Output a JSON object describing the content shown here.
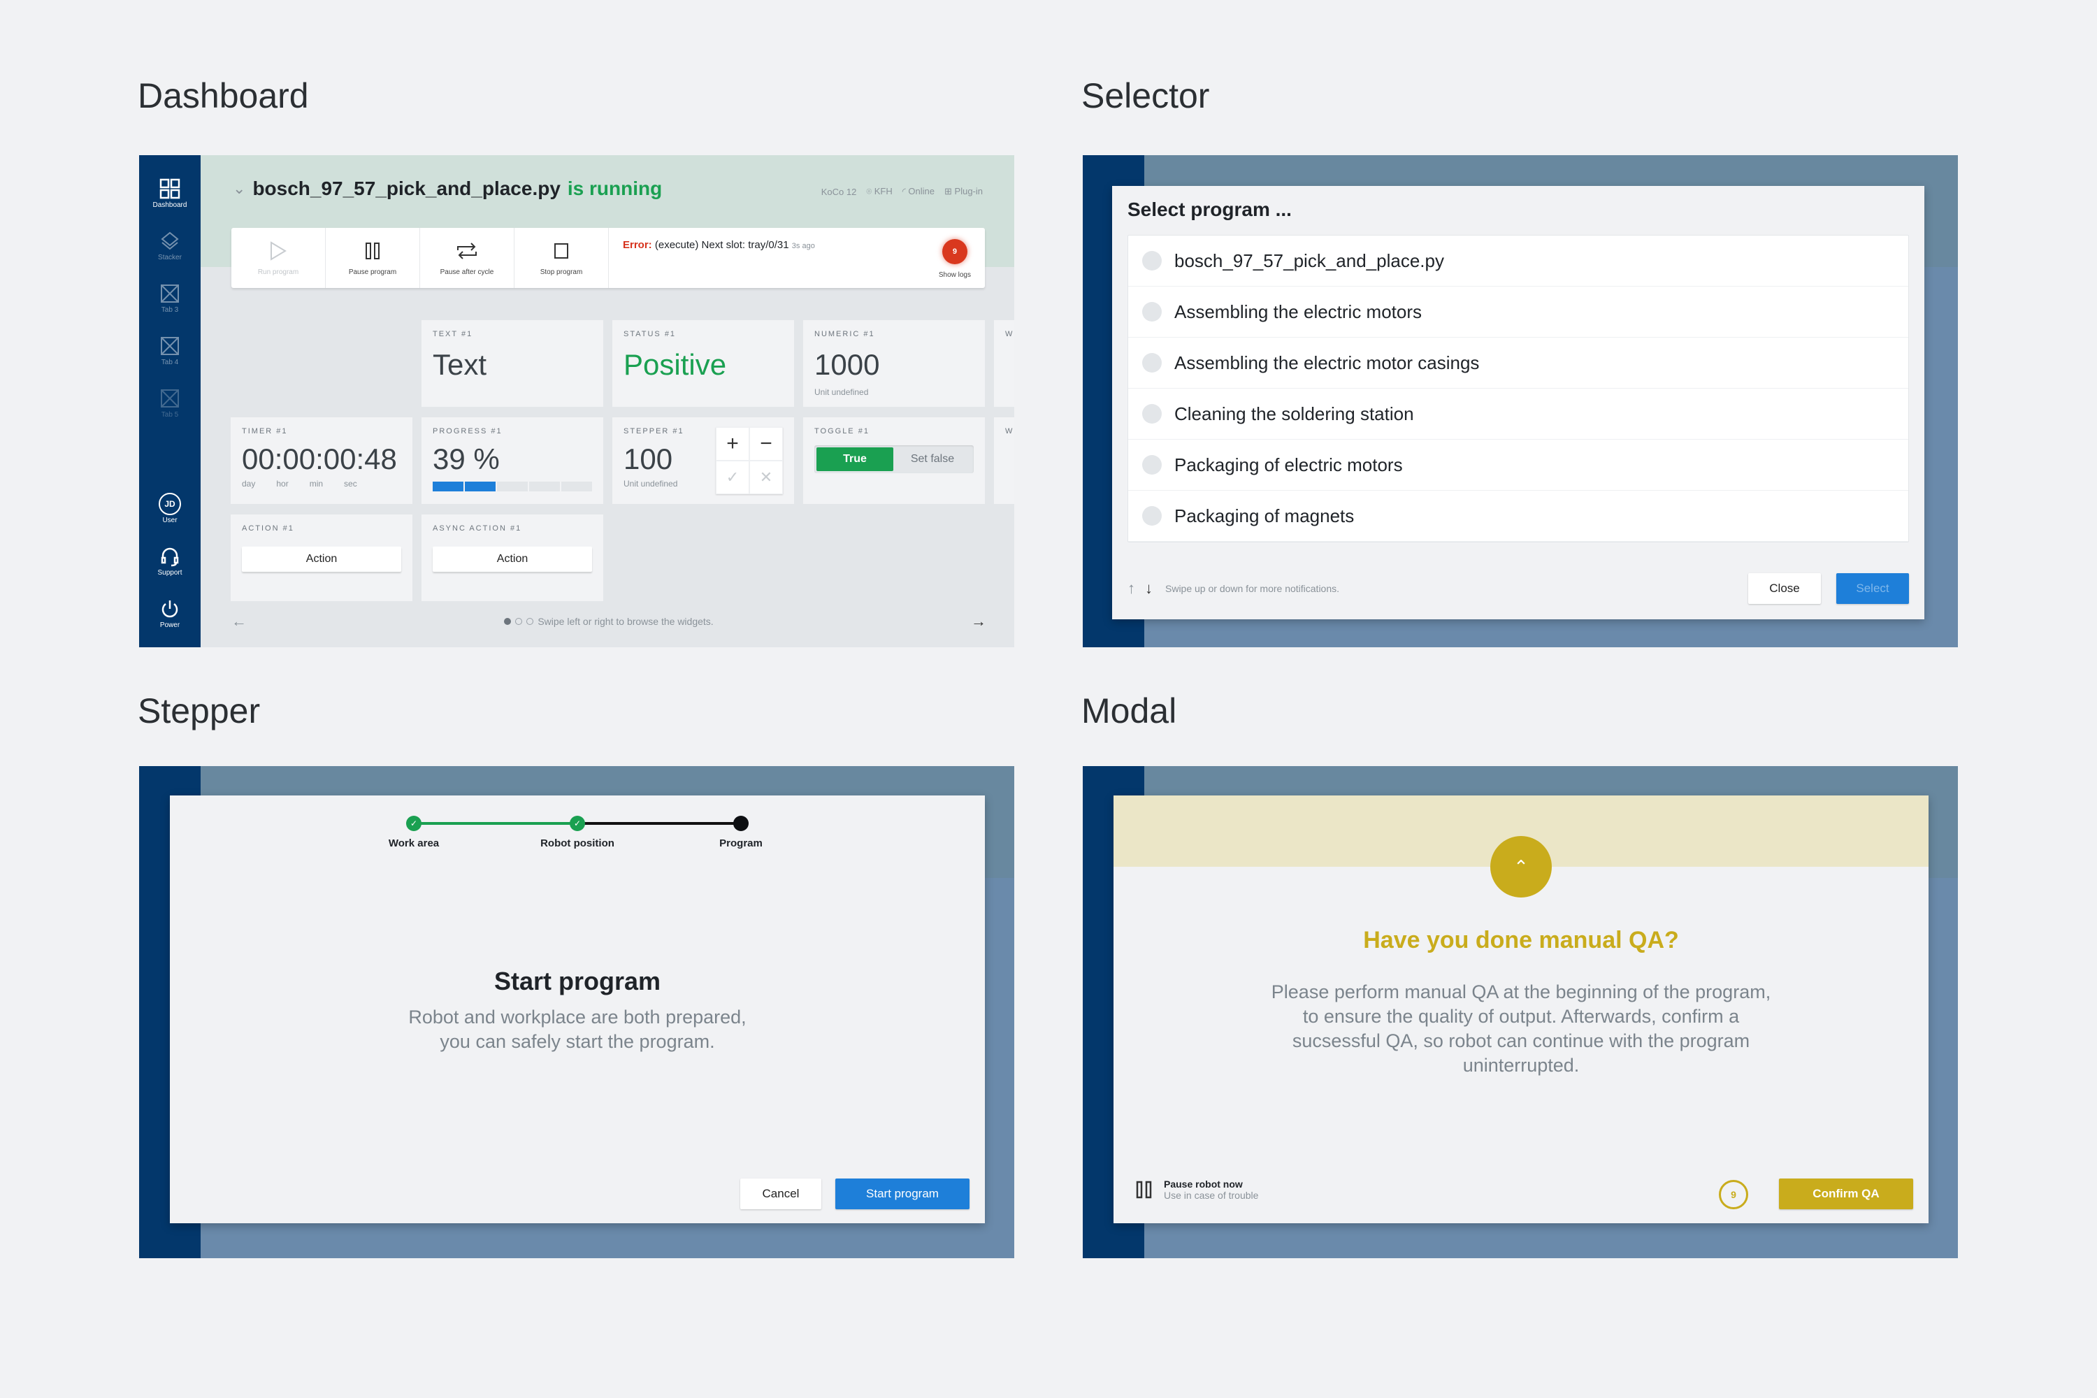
{
  "sections": {
    "dashboard": "Dashboard",
    "selector": "Selector",
    "stepper": "Stepper",
    "modal": "Modal"
  },
  "sidebar": {
    "items": [
      {
        "label": "Dashboard",
        "icon": "grid-icon"
      },
      {
        "label": "Stacker",
        "icon": "layers-icon"
      },
      {
        "label": "Tab 3",
        "icon": "placeholder-icon"
      },
      {
        "label": "Tab 4",
        "icon": "placeholder-icon"
      },
      {
        "label": "Tab 5",
        "icon": "placeholder-icon"
      }
    ],
    "bottom": [
      {
        "label": "User",
        "initials": "JD"
      },
      {
        "label": "Support",
        "icon": "headset-icon"
      },
      {
        "label": "Power",
        "icon": "power-icon"
      }
    ]
  },
  "dashboard": {
    "program_name": "bosch_97_57_pick_and_place.py",
    "program_status": "is running",
    "meta": {
      "robot": "KoCo 12",
      "location": "KFH",
      "connection": "Online",
      "plugin": "Plug-in"
    },
    "toolbar": {
      "run": "Run program",
      "pause": "Pause program",
      "pause_after_cycle": "Pause after cycle",
      "stop": "Stop program",
      "error_label": "Error:",
      "error_text": "(execute) Next slot: tray/0/31",
      "error_ago": "3s ago",
      "logs_count": "9",
      "logs_label": "Show logs"
    },
    "widgets": {
      "text": {
        "label": "TEXT #1",
        "value": "Text"
      },
      "status": {
        "label": "STATUS #1",
        "value": "Positive",
        "color": "#1aa051"
      },
      "numeric": {
        "label": "NUMERIC #1",
        "value": "1000",
        "unit": "Unit undefined"
      },
      "timer": {
        "label": "TIMER #1",
        "value": "00:00:00:48",
        "units": [
          "day",
          "hor",
          "min",
          "sec"
        ]
      },
      "progress": {
        "label": "PROGRESS #1",
        "value": "39 %",
        "percent": 39
      },
      "stepper": {
        "label": "STEPPER #1",
        "value": "100",
        "unit": "Unit undefined",
        "plus": "+",
        "minus": "−",
        "confirm": "✓",
        "cancel": "✕"
      },
      "toggle": {
        "label": "TOGGLE #1",
        "on": "True",
        "off": "Set false"
      },
      "action": {
        "label": "ACTION #1",
        "button": "Action"
      },
      "async_action": {
        "label": "ASYNC ACTION #1",
        "button": "Action"
      },
      "partial_label": "W"
    },
    "footer": {
      "hint": "Swipe left or right to browse the widgets.",
      "page": 1,
      "pages": 3
    }
  },
  "selector": {
    "title": "Select program ...",
    "options": [
      "bosch_97_57_pick_and_place.py",
      "Assembling the electric motors",
      "Assembling the electric motor casings",
      "Cleaning the soldering station",
      "Packaging of electric motors",
      "Packaging of magnets"
    ],
    "hint": "Swipe up or down for more notifications.",
    "close": "Close",
    "select": "Select"
  },
  "stepper_panel": {
    "steps": [
      {
        "label": "Work area",
        "state": "done"
      },
      {
        "label": "Robot position",
        "state": "done"
      },
      {
        "label": "Program",
        "state": "current"
      }
    ],
    "title": "Start program",
    "body_line1": "Robot and workplace are both prepared,",
    "body_line2": "you can safely start the program.",
    "cancel": "Cancel",
    "confirm": "Start program"
  },
  "modal": {
    "title": "Have you done manual QA?",
    "body": "Please perform manual QA at the beginning of the program, to ensure the quality of output. Afterwards, confirm a sucsessful QA, so robot can continue with the program uninterrupted.",
    "pause_title": "Pause robot now",
    "pause_sub": "Use in case of trouble",
    "countdown": "9",
    "confirm": "Confirm QA",
    "accent": "#c9ac1c"
  }
}
